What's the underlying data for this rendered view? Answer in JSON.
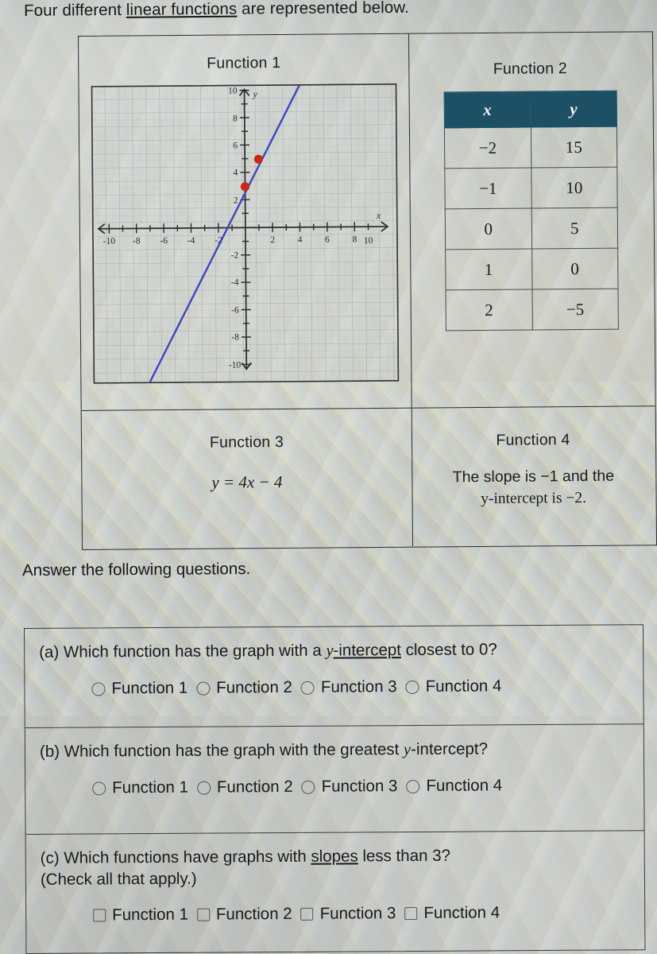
{
  "intro": {
    "before": "Four different ",
    "link": "linear functions",
    "after": " are represented below."
  },
  "functions": {
    "f1": {
      "title": "Function 1",
      "graph": {
        "x_ticks": [
          "-10",
          "-8",
          "-6",
          "-4",
          "2",
          "4",
          "6",
          "8",
          "10"
        ],
        "y_ticks": [
          "10",
          "8",
          "6",
          "4",
          "-2",
          "-4",
          "-6",
          "-8",
          "-10"
        ],
        "x_axis_label": "x",
        "y_axis_label": "y",
        "points": [
          [
            0,
            3
          ],
          [
            1,
            5
          ]
        ],
        "slope": 2,
        "y_intercept": 3,
        "line_color": "#3b46c4",
        "point_color": "#c62a16",
        "xlim": [
          -11,
          11
        ],
        "ylim": [
          -11,
          11
        ]
      }
    },
    "f2": {
      "title": "Function 2",
      "table": {
        "headers": [
          "x",
          "y"
        ],
        "rows": [
          [
            "−2",
            "15"
          ],
          [
            "−1",
            "10"
          ],
          [
            "0",
            "5"
          ],
          [
            "1",
            "0"
          ],
          [
            "2",
            "−5"
          ]
        ],
        "header_bg": "#1d5064"
      }
    },
    "f3": {
      "title": "Function 3",
      "equation": "y = 4x − 4"
    },
    "f4": {
      "title": "Function 4",
      "description_line1": "The slope is −1 and the",
      "description_line2": "y-intercept is −2."
    }
  },
  "answer_prompt": "Answer the following questions.",
  "questions": [
    {
      "id": "a",
      "text_before": "(a) Which function has the graph with a ",
      "text_italic": "y",
      "text_link": "-intercept",
      "text_after": " closest to 0?",
      "input_type": "radio",
      "options": [
        "Function 1",
        "Function 2",
        "Function 3",
        "Function 4"
      ]
    },
    {
      "id": "b",
      "text_before": "(b) Which function has the graph with the greatest ",
      "text_italic": "y",
      "text_link": "",
      "text_after": "-intercept?",
      "input_type": "radio",
      "options": [
        "Function 1",
        "Function 2",
        "Function 3",
        "Function 4"
      ]
    },
    {
      "id": "c",
      "text_before": "(c) Which functions have graphs with ",
      "text_italic": "",
      "text_link": "slopes",
      "text_after": " less than 3?",
      "text_line2": "(Check all that apply.)",
      "input_type": "checkbox",
      "options": [
        "Function 1",
        "Function 2",
        "Function 3",
        "Function 4"
      ]
    }
  ]
}
